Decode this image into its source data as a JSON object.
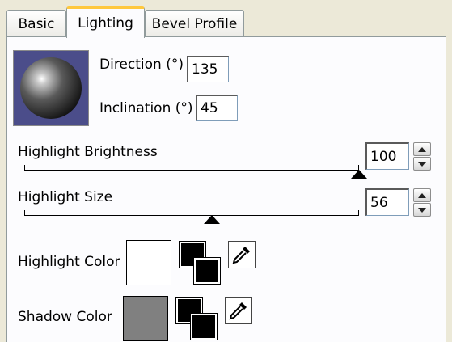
{
  "tabs": [
    {
      "label": "Basic"
    },
    {
      "label": "Lighting"
    },
    {
      "label": "Bevel Profile"
    }
  ],
  "active_tab": "Lighting",
  "lighting": {
    "direction_label": "Direction (°)",
    "direction_value": "135",
    "inclination_label": "Inclination (°)",
    "inclination_value": "45",
    "highlight_brightness_label": "Highlight Brightness",
    "highlight_brightness_value": "100",
    "highlight_brightness_level": 1.0,
    "highlight_size_label": "Highlight Size",
    "highlight_size_value": "56",
    "highlight_size_level": 0.56,
    "highlight_color_label": "Highlight Color",
    "highlight_color": "#ffffff",
    "shadow_color_label": "Shadow Color",
    "shadow_color": "#808080"
  },
  "icons": {
    "preview": "shaded-sphere-icon",
    "swap": "swap-colors-icon",
    "picker": "eyedropper-icon",
    "spin": "spin-arrows-icon"
  },
  "colors": {
    "preview_bg": "#4b4d8a",
    "tab_accent": "#ffc83c"
  }
}
